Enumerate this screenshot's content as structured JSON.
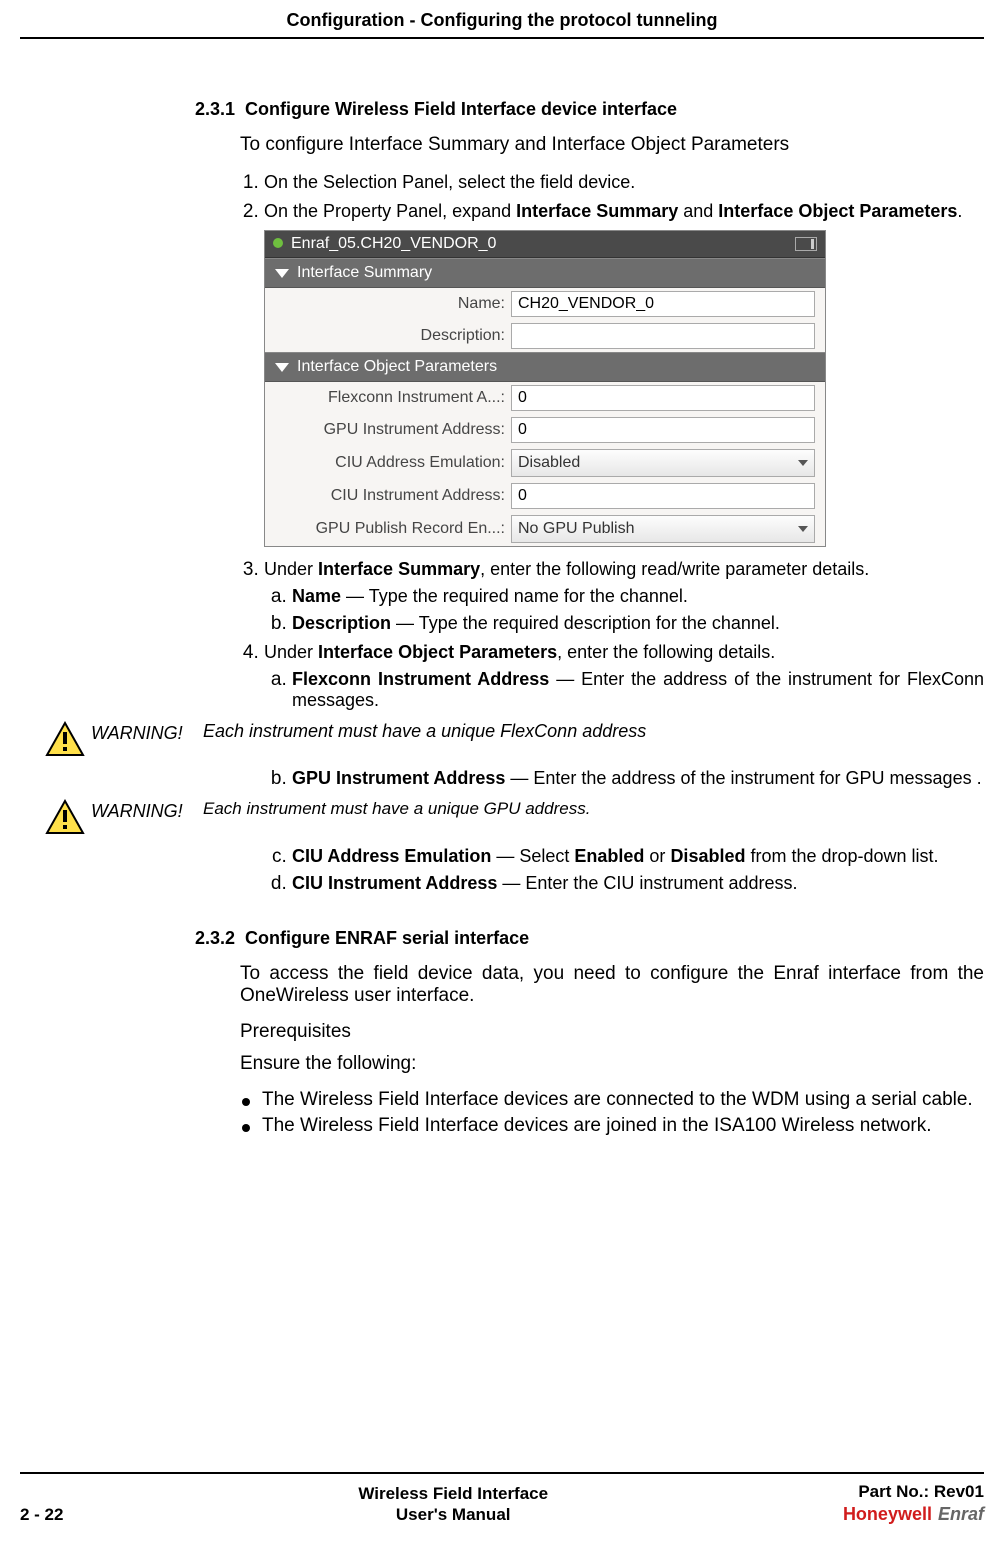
{
  "header_title": "Configuration - Configuring the protocol tunneling",
  "sec231": {
    "num": "2.3.1",
    "title": "Configure Wireless Field Interface device interface",
    "intro": "To configure Interface Summary and Interface Object Parameters",
    "step1": "On the Selection Panel, select the field device.",
    "step2_pre": "On the Property Panel, expand ",
    "step2_b1": "Interface Summary",
    "step2_mid": " and ",
    "step2_b2": "Interface Object Parameters",
    "step2_suf": ".",
    "step3_pre": "Under ",
    "step3_b": "Interface Summary",
    "step3_suf": ", enter the following read/write parameter details.",
    "step3a_b": "Name",
    "step3a_t": " — Type the required name for the channel.",
    "step3b_b": "Description",
    "step3b_t": " — Type the required description for the channel.",
    "step4_pre": "Under ",
    "step4_b": "Interface Object Parameters",
    "step4_suf": ", enter the following details.",
    "step4a_b": "Flexconn Instrument Address",
    "step4a_t": " — Enter the address of the instrument for FlexConn messages.",
    "step4b_b": "GPU Instrument Address",
    "step4b_t": " — Enter the address of the instrument for GPU messages .",
    "step4c_b": "CIU Address Emulation",
    "step4c_t1": " — Select ",
    "step4c_b2": "Enabled",
    "step4c_t2": " or ",
    "step4c_b3": "Disabled",
    "step4c_t3": " from the drop-down list.",
    "step4d_b": "CIU Instrument Address",
    "step4d_t": " — Enter the CIU instrument address."
  },
  "warn1": {
    "label": "WARNING!",
    "text": "Each instrument must have a unique FlexConn address"
  },
  "warn2": {
    "label": "WARNING!",
    "text": "Each instrument must have a unique GPU address."
  },
  "ui_panel": {
    "title": "Enraf_05.CH20_VENDOR_0",
    "summary_head": "Interface Summary",
    "name_label": "Name:",
    "name_value": "CH20_VENDOR_0",
    "desc_label": "Description:",
    "desc_value": "",
    "object_head": "Interface Object Parameters",
    "flex_label": "Flexconn Instrument A...:",
    "flex_value": "0",
    "gpu_label": "GPU Instrument Address:",
    "gpu_value": "0",
    "ciu_emu_label": "CIU Address Emulation:",
    "ciu_emu_value": "Disabled",
    "ciu_addr_label": "CIU Instrument Address:",
    "ciu_addr_value": "0",
    "gpu_pub_label": "GPU Publish Record En...:",
    "gpu_pub_value": "No GPU Publish"
  },
  "sec232": {
    "num": "2.3.2",
    "title": "Configure ENRAF serial interface",
    "p1": "To access the field device data, you need to configure the Enraf interface from the OneWireless user interface.",
    "p2": "Prerequisites",
    "p3": "Ensure the following:",
    "b1": "The Wireless Field Interface devices are connected to the WDM using a serial cable.",
    "b2": "The Wireless Field Interface devices are joined in the ISA100 Wireless network."
  },
  "footer": {
    "page": "2 - 22",
    "mid1": "Wireless Field Interface",
    "mid2": "User's Manual",
    "right": "Part No.: Rev01",
    "brand1": "Honeywell",
    "brand2": "Enraf"
  }
}
